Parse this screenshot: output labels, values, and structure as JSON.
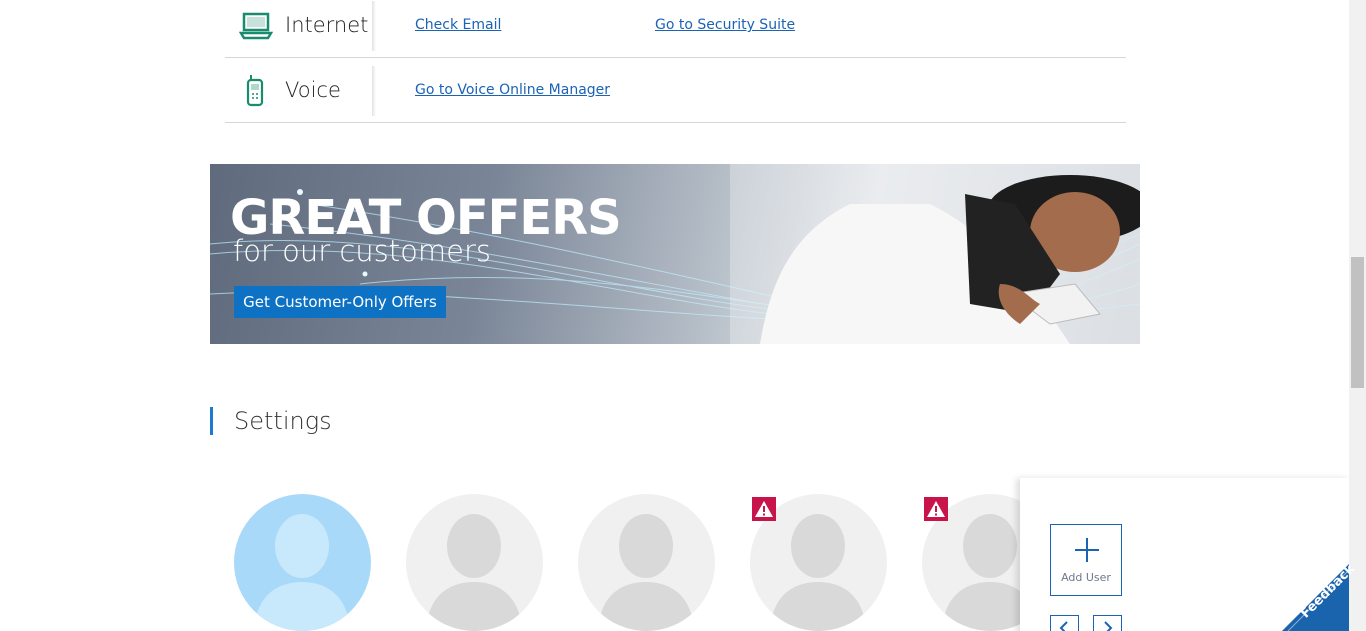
{
  "services": [
    {
      "name": "Internet",
      "icon": "laptop-icon",
      "links": [
        "Check Email",
        "Go to Security Suite"
      ]
    },
    {
      "name": "Voice",
      "icon": "phone-icon",
      "links": [
        "Go to Voice Online Manager"
      ]
    }
  ],
  "banner": {
    "title": "GREAT OFFERS",
    "subtitle": "for our customers",
    "cta": "Get Customer-Only Offers"
  },
  "settings": {
    "title": "Settings",
    "add_user_label": "Add User"
  },
  "colors": {
    "link": "#1b63b5",
    "accent": "#1a7bd0",
    "warning": "#c8134b",
    "cta": "#0d72c4"
  },
  "feedback_label": "Feedback"
}
